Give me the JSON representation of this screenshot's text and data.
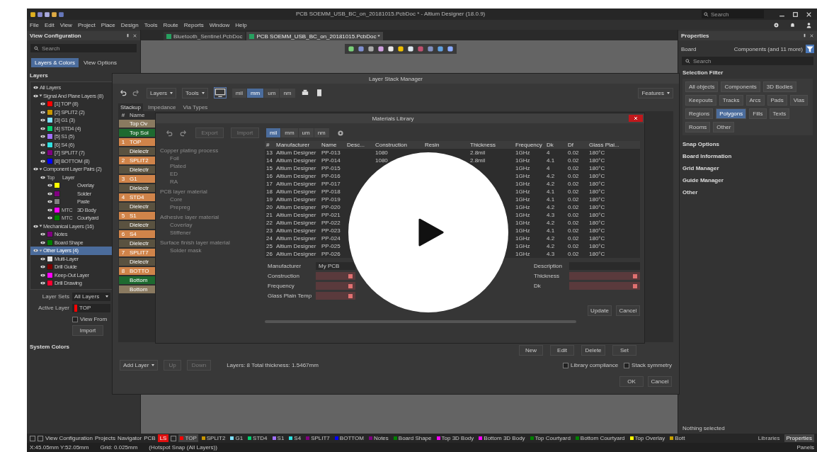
{
  "window": {
    "title": "PCB SOEMM_USB_BC_on_20181015.PcbDoc * - Altium Designer (18.0.9)",
    "search": "Search"
  },
  "menu": [
    "File",
    "Edit",
    "View",
    "Project",
    "Place",
    "Design",
    "Tools",
    "Route",
    "Reports",
    "Window",
    "Help"
  ],
  "left_panel": {
    "title": "View Configuration",
    "search": "Search",
    "tabs": [
      {
        "label": "Layers & Colors",
        "selected": true
      },
      {
        "label": "View Options",
        "selected": false
      }
    ],
    "section": "Layers",
    "layers": [
      {
        "label": "All Layers",
        "selected": false
      },
      {
        "label": "Signal And Plane Layers (8)",
        "expanded": true,
        "selected": false,
        "children": [
          {
            "label": "[1] TOP (8)",
            "color": "#ff0000"
          },
          {
            "label": "[2] SPLIT2 (2)",
            "color": "#c89600"
          },
          {
            "label": "[3] G1 (3)",
            "color": "#80e0ff"
          },
          {
            "label": "[4] STD4 (4)",
            "color": "#00d070"
          },
          {
            "label": "[5] S1 (5)",
            "color": "#a070ff"
          },
          {
            "label": "[6] S4 (6)",
            "color": "#30e0e0"
          },
          {
            "label": "[7] SPLIT7 (7)",
            "color": "#800080"
          },
          {
            "label": "[8] BOTTOM (8)",
            "color": "#0000ff"
          }
        ]
      },
      {
        "label": "Component Layer Pairs (2)",
        "expanded": true,
        "selected": false,
        "children": [
          {
            "prefix": "Top",
            "label": "Layer",
            "children": [
              {
                "label": "Overlay",
                "color": "#ffff00"
              },
              {
                "label": "Solder",
                "color": "#800080"
              },
              {
                "label": "Paste",
                "color": "#808080"
              },
              {
                "prefix": "MTC",
                "label": "3D Body",
                "color": "#ff00ff"
              },
              {
                "prefix": "MTC",
                "label": "Courtyard",
                "color": "#008000"
              }
            ]
          }
        ]
      },
      {
        "label": "Mechanical Layers (16)",
        "expanded": true,
        "selected": false,
        "children": [
          {
            "label": "Notes",
            "color": "#800080"
          },
          {
            "label": "Board Shape",
            "color": "#008000"
          }
        ]
      },
      {
        "label": "Other Layers (4)",
        "expanded": true,
        "selected": true,
        "children": [
          {
            "label": "Multi-Layer",
            "color": "#e0e0e0"
          },
          {
            "label": "Drill Guide",
            "color": "#800000"
          },
          {
            "label": "Keep-Out Layer",
            "color": "#ff00ff"
          },
          {
            "label": "Drill Drawing",
            "color": "#ff0030"
          }
        ]
      }
    ],
    "layer_sets": {
      "label": "Layer Sets",
      "value": "All Layers"
    },
    "active_layer": {
      "label": "Active Layer",
      "value": "TOP",
      "color": "#ff0000"
    },
    "view_from": {
      "label": "View From",
      "checked": false
    },
    "import_button": "Import",
    "system_colors": "System Colors"
  },
  "documents": [
    {
      "label": "Bluetooth_Sentinel.PcbDoc",
      "selected": false
    },
    {
      "label": "PCB SOEMM_USB_BC_on_20181015.PcbDoc *",
      "selected": true
    }
  ],
  "right_panel": {
    "title": "Properties",
    "board_label": "Board",
    "board_value": "Components (and 11 more)",
    "search": "Search",
    "filter_title": "Selection Filter",
    "filters": [
      {
        "label": "All objects",
        "selected": false
      },
      {
        "label": "Components",
        "selected": false
      },
      {
        "label": "3D Bodies",
        "selected": false
      },
      {
        "label": "Keepouts",
        "selected": false
      },
      {
        "label": "Tracks",
        "selected": false
      },
      {
        "label": "Arcs",
        "selected": false
      },
      {
        "label": "Pads",
        "selected": false
      },
      {
        "label": "Vias",
        "selected": false
      },
      {
        "label": "Regions",
        "selected": false
      },
      {
        "label": "Polygons",
        "selected": true
      },
      {
        "label": "Fills",
        "selected": false
      },
      {
        "label": "Texts",
        "selected": false
      },
      {
        "label": "Rooms",
        "selected": false
      },
      {
        "label": "Other",
        "selected": false
      }
    ],
    "sections": [
      "Snap Options",
      "Board Information",
      "Grid Manager",
      "Guide Manager",
      "Other"
    ],
    "status": "Nothing selected"
  },
  "layer_stack": {
    "title": "Layer Stack Manager",
    "menus": [
      "Layers",
      "Tools"
    ],
    "units": [
      {
        "label": "mil",
        "selected": false
      },
      {
        "label": "mm",
        "selected": true
      },
      {
        "label": "um",
        "selected": false
      },
      {
        "label": "nm",
        "selected": false
      }
    ],
    "features": "Features",
    "tabs": [
      {
        "label": "Stackup",
        "selected": true
      },
      {
        "label": "Impedance",
        "selected": false
      },
      {
        "label": "Via Types",
        "selected": false
      }
    ],
    "columns": [
      "#",
      "Name"
    ],
    "rows": [
      {
        "num": "",
        "name": "Top Ov",
        "color": "#8a7a60"
      },
      {
        "num": "",
        "name": "Top Sol",
        "color": "#1e6a30"
      },
      {
        "num": "1",
        "name": "TOP",
        "color": "#d0844a"
      },
      {
        "num": "",
        "name": "Dielectr",
        "color": "#5a5240"
      },
      {
        "num": "2",
        "name": "SPLIT2",
        "color": "#d0844a"
      },
      {
        "num": "",
        "name": "Dielectr",
        "color": "#5a5240"
      },
      {
        "num": "3",
        "name": "G1",
        "color": "#d0844a"
      },
      {
        "num": "",
        "name": "Dielectr",
        "color": "#5a5240"
      },
      {
        "num": "4",
        "name": "STD4",
        "color": "#d0844a"
      },
      {
        "num": "",
        "name": "Dielectr",
        "color": "#5a5240"
      },
      {
        "num": "5",
        "name": "S1",
        "color": "#d0844a"
      },
      {
        "num": "",
        "name": "Dielectr",
        "color": "#5a5240"
      },
      {
        "num": "6",
        "name": "S4",
        "color": "#d0844a"
      },
      {
        "num": "",
        "name": "Dielectr",
        "color": "#5a5240"
      },
      {
        "num": "7",
        "name": "SPLIT7",
        "color": "#d0844a"
      },
      {
        "num": "",
        "name": "Dielectr",
        "color": "#5a5240"
      },
      {
        "num": "8",
        "name": "BOTTO",
        "color": "#d0844a"
      },
      {
        "num": "",
        "name": "Bottom",
        "color": "#1e6a30"
      },
      {
        "num": "",
        "name": "Bottom",
        "color": "#8a7a60"
      }
    ],
    "material_buttons": [
      "New",
      "Edit",
      "Delete",
      "Set"
    ],
    "add_layer": "Add Layer",
    "up": "Up",
    "down": "Down",
    "summary": "Layers: 8   Total thickness: 1.5467mm",
    "checks": [
      {
        "label": "Library compliance",
        "checked": false
      },
      {
        "label": "Stack symmetry",
        "checked": false
      }
    ],
    "ok": "OK",
    "cancel": "Cancel"
  },
  "materials": {
    "title": "Materials Library",
    "export": "Export",
    "import": "Import",
    "units": [
      {
        "label": "mil",
        "selected": true
      },
      {
        "label": "mm",
        "selected": false
      },
      {
        "label": "um",
        "selected": false
      },
      {
        "label": "nm",
        "selected": false
      }
    ],
    "tree": [
      {
        "label": "Copper plating process",
        "children": [
          "Foil",
          "Plated",
          "ED",
          "RA"
        ]
      },
      {
        "label": "PCB layer material",
        "children": [
          "Core",
          "Prepreg"
        ]
      },
      {
        "label": "Adhesive layer material",
        "children": [
          "Coverlay",
          "Stiffener"
        ]
      },
      {
        "label": "Surface finish layer material",
        "children": [
          "Solder mask"
        ]
      }
    ],
    "columns": [
      "#",
      "Manufacturer",
      "Name",
      "Desc...",
      "Construction",
      "Resin",
      "Thickness",
      "Frequency",
      "Dk",
      "Df",
      "Glass Plai..."
    ],
    "rows": [
      {
        "num": "13",
        "manufacturer": "Altium Designer",
        "name": "PP-013",
        "construction": "1080",
        "thickness": "2.8mil",
        "frequency": "1GHz",
        "dk": "4",
        "df": "0.02",
        "tg": "180°C"
      },
      {
        "num": "14",
        "manufacturer": "Altium Designer",
        "name": "PP-014",
        "construction": "1080",
        "thickness": "2.8mil",
        "frequency": "1GHz",
        "dk": "4.1",
        "df": "0.02",
        "tg": "180°C"
      },
      {
        "num": "15",
        "manufacturer": "Altium Designer",
        "name": "PP-015",
        "frequency": "1GHz",
        "dk": "4",
        "df": "0.02",
        "tg": "180°C"
      },
      {
        "num": "16",
        "manufacturer": "Altium Designer",
        "name": "PP-016",
        "frequency": "1GHz",
        "dk": "4.2",
        "df": "0.02",
        "tg": "180°C"
      },
      {
        "num": "17",
        "manufacturer": "Altium Designer",
        "name": "PP-017",
        "frequency": "1GHz",
        "dk": "4.2",
        "df": "0.02",
        "tg": "180°C"
      },
      {
        "num": "18",
        "manufacturer": "Altium Designer",
        "name": "PP-018",
        "frequency": "1GHz",
        "dk": "4.1",
        "df": "0.02",
        "tg": "180°C"
      },
      {
        "num": "19",
        "manufacturer": "Altium Designer",
        "name": "PP-019",
        "frequency": "1GHz",
        "dk": "4.1",
        "df": "0.02",
        "tg": "180°C"
      },
      {
        "num": "20",
        "manufacturer": "Altium Designer",
        "name": "PP-020",
        "frequency": "1GHz",
        "dk": "4.2",
        "df": "0.02",
        "tg": "180°C"
      },
      {
        "num": "21",
        "manufacturer": "Altium Designer",
        "name": "PP-021",
        "frequency": "1GHz",
        "dk": "4.3",
        "df": "0.02",
        "tg": "180°C"
      },
      {
        "num": "22",
        "manufacturer": "Altium Designer",
        "name": "PP-022",
        "frequency": "1GHz",
        "dk": "4.2",
        "df": "0.02",
        "tg": "180°C"
      },
      {
        "num": "23",
        "manufacturer": "Altium Designer",
        "name": "PP-023",
        "frequency": "1GHz",
        "dk": "4.1",
        "df": "0.02",
        "tg": "180°C"
      },
      {
        "num": "24",
        "manufacturer": "Altium Designer",
        "name": "PP-024",
        "frequency": "1GHz",
        "dk": "4.2",
        "df": "0.02",
        "tg": "180°C"
      },
      {
        "num": "25",
        "manufacturer": "Altium Designer",
        "name": "PP-025",
        "frequency": "1GHz",
        "dk": "4.2",
        "df": "0.02",
        "tg": "180°C"
      },
      {
        "num": "26",
        "manufacturer": "Altium Designer",
        "name": "PP-026",
        "frequency": "1GHz",
        "dk": "4.3",
        "df": "0.02",
        "tg": "180°C"
      }
    ],
    "form_left": [
      {
        "label": "Manufacturer",
        "value": "My PCB",
        "error": false
      },
      {
        "label": "Construction",
        "error": true
      },
      {
        "label": "Frequency",
        "error": true
      },
      {
        "label": "Glass Plain Temp",
        "error": true
      }
    ],
    "form_right": [
      {
        "label": "Description",
        "error": false
      },
      {
        "label": "Thickness",
        "error": true
      },
      {
        "label": "Dk",
        "error": true
      }
    ],
    "update": "Update",
    "cancel": "Cancel"
  },
  "bottom_tabs": {
    "panels": [
      "View Configuration",
      "Projects",
      "Navigator",
      "PCB"
    ],
    "active": "LS",
    "layers": [
      {
        "label": "TOP",
        "color": "#ff0000",
        "selected": true
      },
      {
        "label": "SPLIT2",
        "color": "#c89600",
        "selected": false
      },
      {
        "label": "G1",
        "color": "#80e0ff",
        "selected": false
      },
      {
        "label": "STD4",
        "color": "#00d070",
        "selected": false
      },
      {
        "label": "S1",
        "color": "#a070ff",
        "selected": false
      },
      {
        "label": "S4",
        "color": "#30e0e0",
        "selected": false
      },
      {
        "label": "SPLIT7",
        "color": "#800080",
        "selected": false
      },
      {
        "label": "BOTTOM",
        "color": "#0000ff",
        "selected": false
      },
      {
        "label": "Notes",
        "color": "#800080",
        "selected": false
      },
      {
        "label": "Board Shape",
        "color": "#008000",
        "selected": false
      },
      {
        "label": "Top 3D Body",
        "color": "#ff00ff",
        "selected": false
      },
      {
        "label": "Bottom 3D Body",
        "color": "#ff00ff",
        "selected": false
      },
      {
        "label": "Top Courtyard",
        "color": "#008000",
        "selected": false
      },
      {
        "label": "Bottom Courtyard",
        "color": "#008000",
        "selected": false
      },
      {
        "label": "Top Overlay",
        "color": "#ffff00",
        "selected": false
      },
      {
        "label": "Bott",
        "color": "#c8a000",
        "selected": false
      }
    ],
    "right": [
      {
        "label": "Libraries",
        "selected": false
      },
      {
        "label": "Properties",
        "selected": true
      }
    ]
  },
  "status_bar": {
    "coords": "X:45.05mm Y:52.05mm",
    "grid": "Grid: 0.025mm",
    "snap": "(Hotspot Snap (All Layers))",
    "panels": "Panels"
  }
}
